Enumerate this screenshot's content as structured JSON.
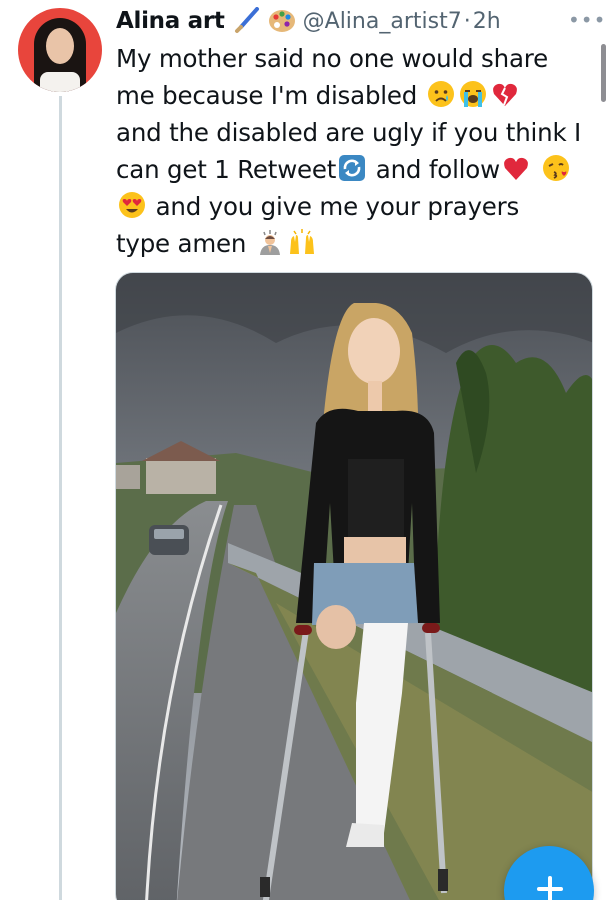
{
  "tweet": {
    "author_name": "Alina art",
    "handle": "@Alina_artist7",
    "separator": "·",
    "time": "2h",
    "lines": [
      "My mother said no one would share",
      "me because I'm disabled",
      "and the disabled are ugly if you think I",
      "can get 1 Retweet",
      "and follow",
      "and you give me your prayers",
      "type amen"
    ],
    "emojis": [
      "paintbrush-icon",
      "palette-icon",
      "crying-face-icon",
      "loudly-crying-face-icon",
      "broken-heart-icon",
      "repeat-icon",
      "red-heart-icon",
      "kissing-face-icon",
      "heart-eyes-face-icon",
      "praying-person-icon",
      "raising-hands-icon"
    ]
  },
  "fab": {
    "icon": "plus-icon"
  },
  "colors": {
    "accent": "#1d9bf0",
    "avatar_bg": "#e8453c",
    "secondary_text": "#536471"
  }
}
